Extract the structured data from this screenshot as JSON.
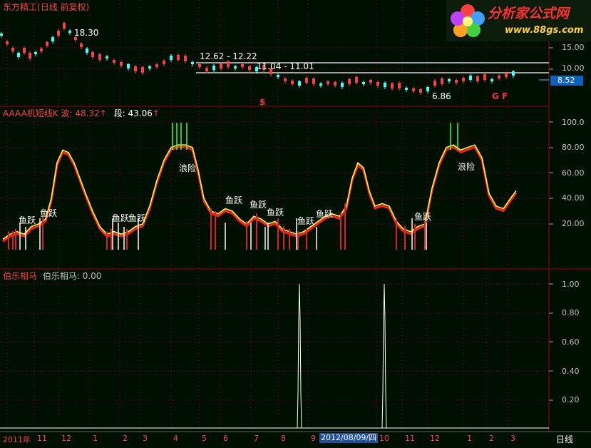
{
  "header": {
    "stock_name": "东方精工",
    "period": "(日线 前复权)"
  },
  "logo": {
    "name": "分析家公式网",
    "url": "www.88gs.com"
  },
  "price_panel": {
    "high_label": "18.30",
    "range1_label": "12.62 - 12.22",
    "range2_label": "11.04 - 11.01",
    "low_label": "6.86",
    "current_price": "8.52",
    "axis": [
      "15.00",
      "10.00"
    ],
    "marker_s": "$",
    "marker_g": "G F"
  },
  "indicator_panel": {
    "name": "AAAA机短线K",
    "wave_label": "波: 48.32",
    "segment_label": "段: 43.06",
    "axis": [
      "100.0",
      "80.00",
      "60.00",
      "40.00",
      "20.00"
    ],
    "signals": {
      "fish": "鱼跃",
      "risk": "浪险"
    }
  },
  "bole_panel": {
    "name": "伯乐相马",
    "value_label": "伯乐相马: 0.00",
    "axis": [
      "1.00",
      "0.80",
      "0.60",
      "0.40",
      "0.20"
    ]
  },
  "time_axis": {
    "year": "2011年",
    "months": [
      "10",
      "11",
      "12",
      "1",
      "2",
      "3",
      "4",
      "5",
      "6",
      "7",
      "8",
      "9",
      "10",
      "11",
      "12",
      "1",
      "2",
      "3"
    ],
    "cursor_date": "2012/08/09/四",
    "period_button": "日线"
  },
  "colors": {
    "background": "#001000",
    "grid": "#a00000",
    "fast_line": "#ffff40",
    "slow_line": "#ff2020",
    "title_red": "#ff4040"
  }
}
